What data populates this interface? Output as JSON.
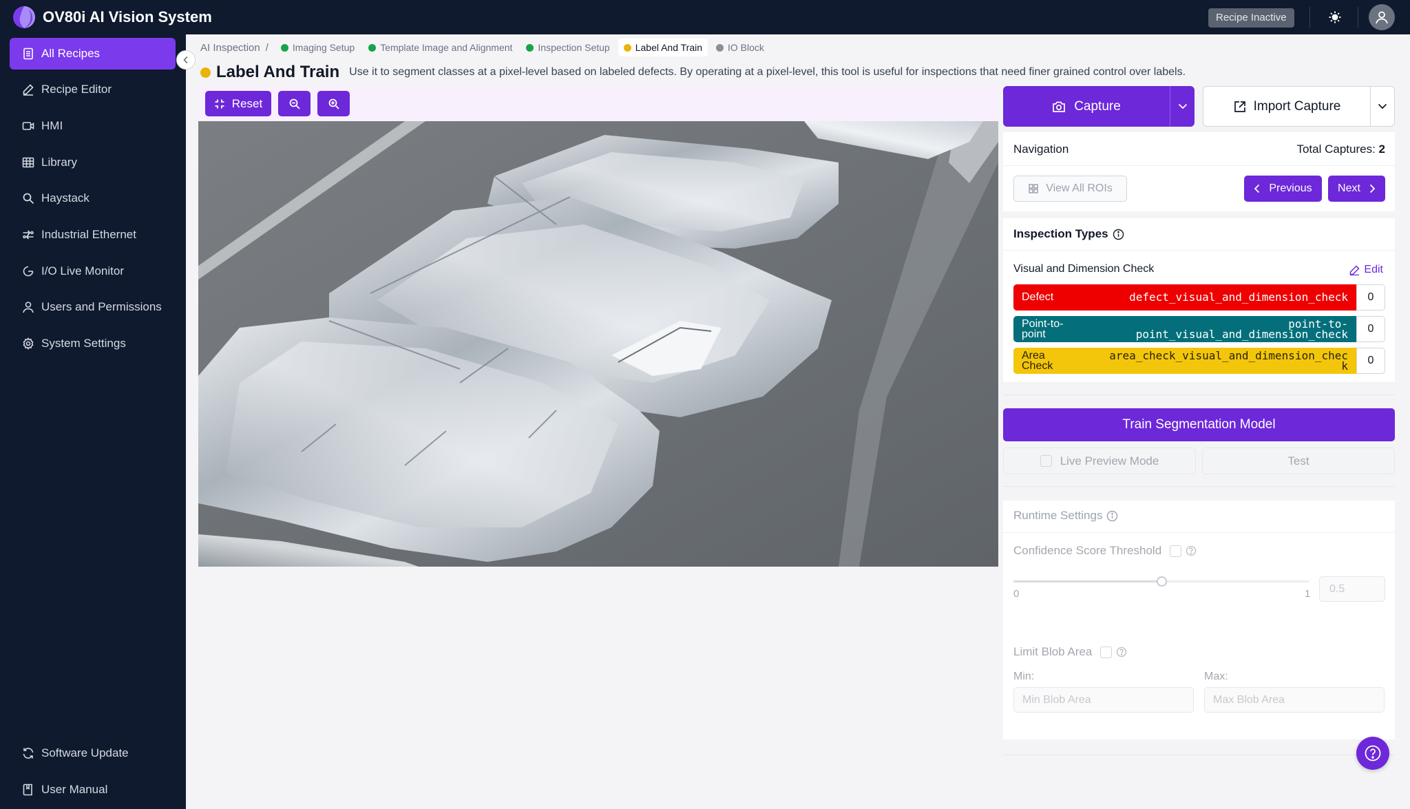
{
  "app": {
    "title": "OV80i AI Vision System",
    "recipe_status": "Recipe Inactive"
  },
  "sidebar": {
    "items": [
      {
        "label": "All Recipes",
        "icon": "document-icon"
      },
      {
        "label": "Recipe Editor",
        "icon": "pencil-icon"
      },
      {
        "label": "HMI",
        "icon": "video-icon"
      },
      {
        "label": "Library",
        "icon": "table-icon"
      },
      {
        "label": "Haystack",
        "icon": "search-icon"
      },
      {
        "label": "Industrial Ethernet",
        "icon": "network-icon"
      },
      {
        "label": "I/O Live Monitor",
        "icon": "monitor-icon"
      },
      {
        "label": "Users and Permissions",
        "icon": "user-icon"
      },
      {
        "label": "System Settings",
        "icon": "gear-icon"
      }
    ],
    "bottom": [
      {
        "label": "Software Update",
        "icon": "refresh-icon"
      },
      {
        "label": "User Manual",
        "icon": "book-icon"
      }
    ]
  },
  "breadcrumb": {
    "root": "AI Inspection",
    "separator": "/",
    "steps": [
      {
        "label": "Imaging Setup",
        "status": "green"
      },
      {
        "label": "Template Image and Alignment",
        "status": "green"
      },
      {
        "label": "Inspection Setup",
        "status": "green"
      },
      {
        "label": "Label And Train",
        "status": "amber",
        "active": true
      },
      {
        "label": "IO Block",
        "status": "gray"
      }
    ]
  },
  "page": {
    "title": "Label And Train",
    "description": "Use it to segment classes at a pixel-level based on labeled defects. By operating at a pixel-level, this tool is useful for inspections that need finer grained control over labels."
  },
  "viewer": {
    "reset_label": "Reset",
    "zoom_out": "zoom-out-icon",
    "zoom_in": "zoom-in-icon"
  },
  "capture": {
    "capture_label": "Capture",
    "import_label": "Import Capture"
  },
  "navigation": {
    "title": "Navigation",
    "total_label": "Total Captures:",
    "total_value": "2",
    "view_all_label": "View All ROIs",
    "previous_label": "Previous",
    "next_label": "Next"
  },
  "inspection_types": {
    "title": "Inspection Types",
    "group": "Visual and Dimension Check",
    "edit_label": "Edit",
    "rows": [
      {
        "name": "Defect",
        "key": "defect_visual_and_dimension_check",
        "count": "0",
        "color": "#ef0000",
        "text_color": "#ffffff"
      },
      {
        "name_l1": "Point-to-",
        "name_l2": "point",
        "key_l1": "point-to-",
        "key_l2": "point_visual_and_dimension_check",
        "count": "0",
        "color": "#046f7a",
        "text_color": "#ffffff"
      },
      {
        "name_l1": "Area",
        "name_l2": "Check",
        "key_l1": "area_check_visual_and_dimension_chec",
        "key_l2": "k",
        "count": "0",
        "color": "#f3c60c",
        "text_color": "#2b2200"
      }
    ]
  },
  "train": {
    "label": "Train Segmentation Model",
    "live_preview_label": "Live Preview Mode",
    "test_label": "Test"
  },
  "runtime": {
    "title": "Runtime Settings",
    "confidence_label": "Confidence Score Threshold",
    "slider_min": "0",
    "slider_max": "1",
    "slider_value": 0.5,
    "confidence_placeholder": "0.5",
    "blob_label": "Limit Blob Area",
    "min_label": "Min:",
    "max_label": "Max:",
    "min_placeholder": "Min Blob Area",
    "max_placeholder": "Max Blob Area"
  },
  "colors": {
    "accent": "#6d28d9",
    "sidebar_bg": "#0f1a2e",
    "active_nav": "#7c3aed"
  }
}
